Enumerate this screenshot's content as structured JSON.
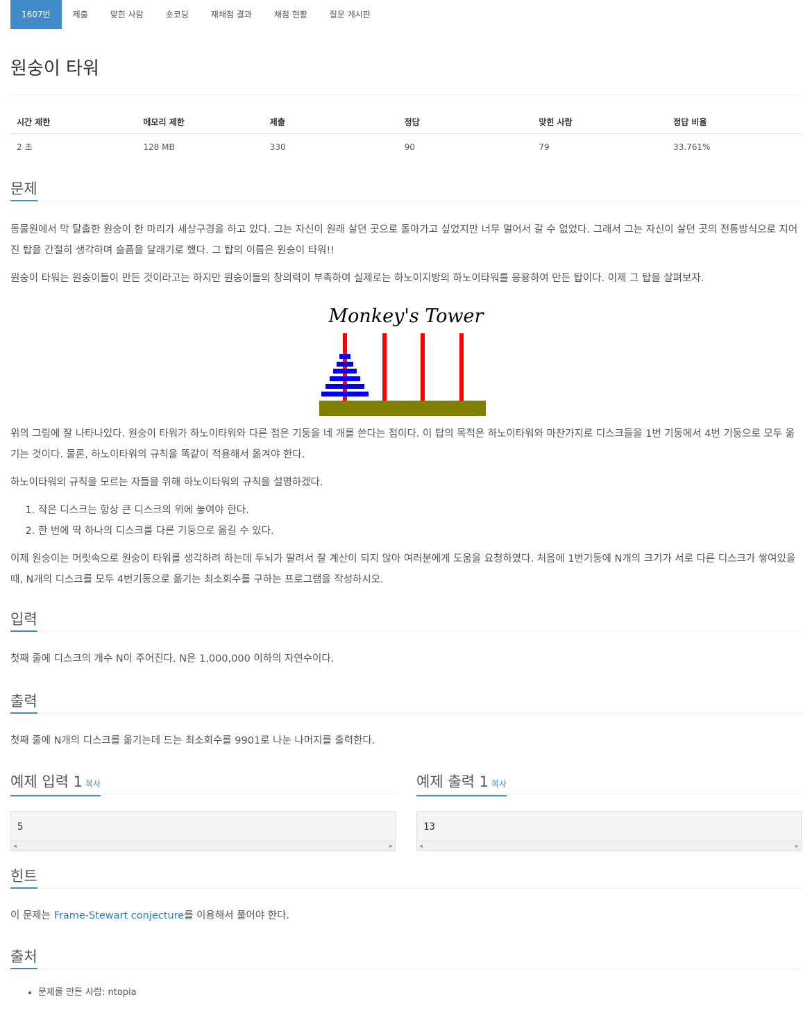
{
  "tabs": [
    {
      "label": "1607번",
      "active": true
    },
    {
      "label": "제출"
    },
    {
      "label": "맞힌 사람"
    },
    {
      "label": "숏코딩"
    },
    {
      "label": "재채점 결과"
    },
    {
      "label": "채점 현황"
    },
    {
      "label": "질문 게시판"
    }
  ],
  "title": "원숭이 타워",
  "info": {
    "headers": [
      "시간 제한",
      "메모리 제한",
      "제출",
      "정답",
      "맞힌 사람",
      "정답 비율"
    ],
    "values": [
      "2 초",
      "128 MB",
      "330",
      "90",
      "79",
      "33.761%"
    ]
  },
  "sections": {
    "problem": "문제",
    "input": "입력",
    "output": "출력",
    "sample_input": "예제 입력 1",
    "sample_output": "예제 출력 1",
    "copy": "복사",
    "hint": "힌트",
    "source": "출처"
  },
  "problem": {
    "p1": "동물원에서 막 탈출한 원숭이 한 마리가 세상구경을 하고 있다. 그는 자신이 원래 살던 곳으로 돌아가고 싶었지만 너무 멀어서 갈 수 없었다. 그래서 그는 자신이 살던 곳의 전통방식으로 지어진 탑을 간절히 생각하며 슬픔을 달래기로 했다. 그 탑의 이름은 원숭이 타워!!",
    "p2": "원숭이 타워는 원숭이들이 만든 것이라고는 하지만 원숭이들의 창의력이 부족하여 실제로는 하노이지방의 하노이타워를 응용하여 만든 탑이다. 이제 그 탑을 살펴보자.",
    "figure_caption": "Monkey's Tower",
    "p3": "위의 그림에 잘 나타나있다. 원숭이 타워가 하노이타워와 다른 점은 기둥을 네 개를 쓴다는 점이다. 이 탑의 목적은 하노이타워와 마찬가지로 디스크들을 1번 기둥에서 4번 기둥으로 모두 옮기는 것이다. 물론, 하노이타워의 규칙을 똑같이 적용해서 옮겨야 한다.",
    "p4": "하노이타워의 규칙을 모르는 자들을 위해 하노이타워의 규칙을 설명하겠다.",
    "rules": [
      "작은 디스크는 항상 큰 디스크의 위에 놓여야 한다.",
      "한 번에 딱 하나의 디스크를 다른 기둥으로 옮길 수 있다."
    ],
    "p5": "이제 원숭이는 머릿속으로 원숭이 타워를 생각하려 하는데 두뇌가 딸려서 잘 계산이 되지 않아 여러분에게 도움을 요청하였다. 처음에 1번기둥에 N개의 크기가 서로 다른 디스크가 쌓여있을 때, N개의 디스크를 모두 4번기둥으로 옮기는 최소회수를 구하는 프로그램을 작성하시오."
  },
  "input_text": "첫째 줄에 디스크의 개수 N이 주어진다. N은 1,000,000 이하의 자연수이다.",
  "output_text": "첫째 줄에 N개의 디스크를 옮기는데 드는 최소회수를 9901로 나눈 나머지를 출력한다.",
  "sample_input_value": "5",
  "sample_output_value": "13",
  "hint": {
    "before": "이 문제는 ",
    "link": "Frame-Stewart conjecture",
    "after": "를 이용해서 풀어야 한다."
  },
  "source_items": [
    "문제를 만든 사람: ntopia"
  ],
  "colors": {
    "accent": "#428bca",
    "peg": "#ff0000",
    "disk": "#0000ee",
    "base": "#808000"
  },
  "icons": [
    "scroll-left-icon",
    "scroll-right-icon"
  ]
}
